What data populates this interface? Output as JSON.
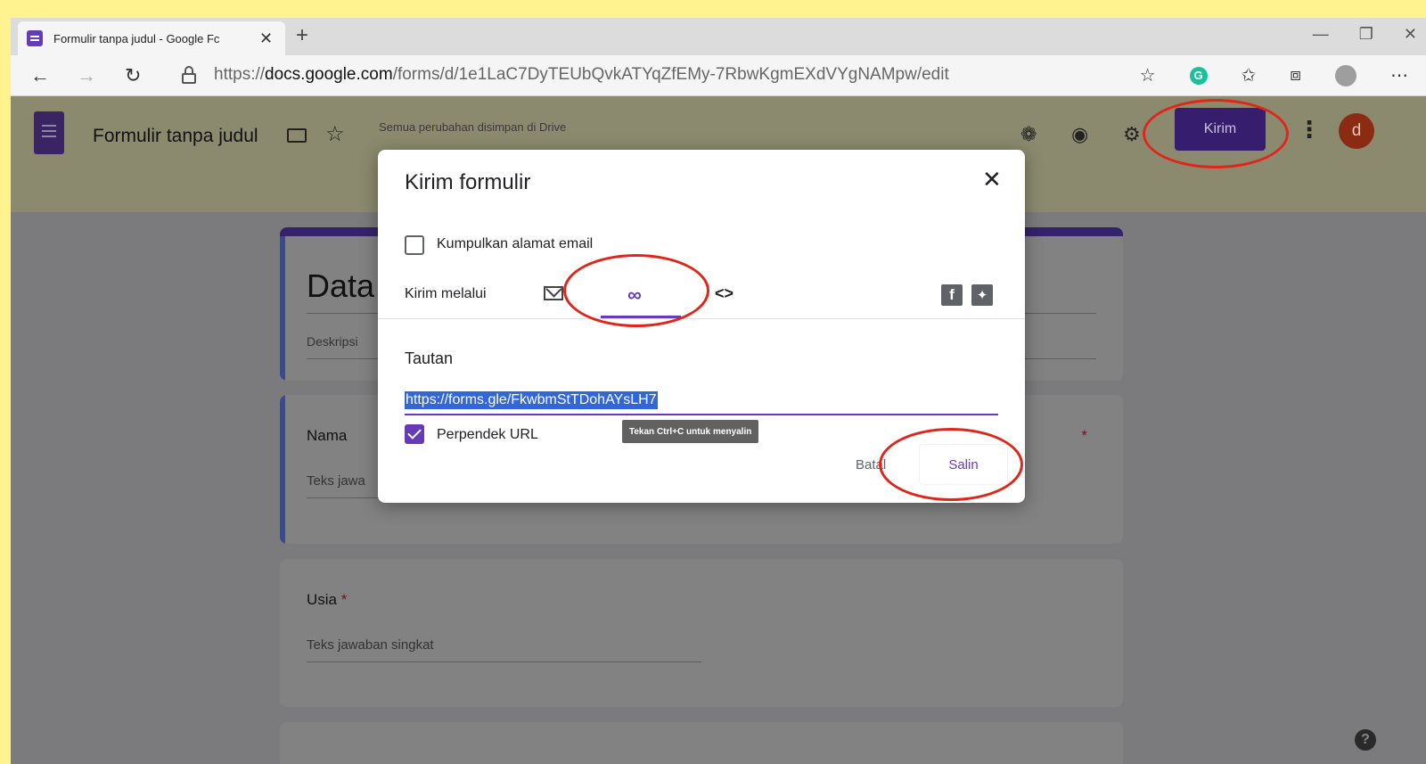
{
  "browser": {
    "tab_title": "Formulir tanpa judul - Google Fc",
    "tab_close": "✕",
    "new_tab": "+",
    "url_scheme": "https://",
    "url_host": "docs.google.com",
    "url_path": "/forms/d/1e1LaC7DyTEUbQvkATYqZfEMy-7RbwKgmEXdVYgNAMpw/edit"
  },
  "app_header": {
    "doc_title": "Formulir tanpa judul",
    "save_status": "Semua perubahan disimpan di Drive",
    "send_button": "Kirim",
    "avatar_letter": "d"
  },
  "form": {
    "heading": "Data",
    "description": "Deskripsi",
    "questions": [
      {
        "label": "Nama",
        "answer_placeholder": "Teks jawa"
      },
      {
        "label": "Usia",
        "required_mark": "*",
        "answer_placeholder": "Teks jawaban singkat"
      }
    ],
    "required_mark": "*"
  },
  "dialog": {
    "title": "Kirim formulir",
    "close": "✕",
    "collect_email_label": "Kumpulkan alamat email",
    "collect_email_checked": false,
    "send_via_label": "Kirim melalui",
    "active_tab": "link",
    "embed_glyph": "<>",
    "link_heading": "Tautan",
    "link_value": "https://forms.gle/FkwbmStTDohAYsLH7",
    "shorten_label": "Perpendek URL",
    "shorten_checked": true,
    "tooltip": "Tekan Ctrl+C untuk menyalin",
    "cancel_button": "Batal",
    "copy_button": "Salin"
  },
  "help_glyph": "?",
  "colors": {
    "accent_purple": "#673ab7",
    "annotation_red": "#e0261b",
    "background_yellow": "#fff38f"
  }
}
